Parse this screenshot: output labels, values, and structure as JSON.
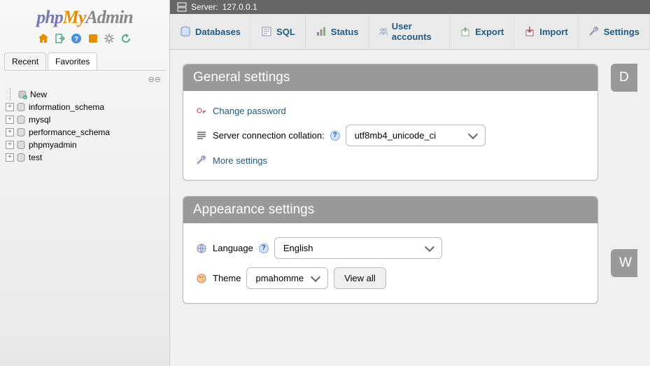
{
  "logo": {
    "php": "php",
    "my": "My",
    "admin": "Admin"
  },
  "sidebar": {
    "tabs": [
      "Recent",
      "Favorites"
    ],
    "activeTab": 0,
    "newLabel": "New",
    "databases": [
      "information_schema",
      "mysql",
      "performance_schema",
      "phpmyadmin",
      "test"
    ]
  },
  "breadcrumb": {
    "serverLabel": "Server:",
    "serverValue": "127.0.0.1"
  },
  "topnav": [
    "Databases",
    "SQL",
    "Status",
    "User accounts",
    "Export",
    "Import",
    "Settings"
  ],
  "general": {
    "title": "General settings",
    "changePassword": "Change password",
    "collationLabel": "Server connection collation:",
    "collationValue": "utf8mb4_unicode_ci",
    "moreSettings": "More settings"
  },
  "appearance": {
    "title": "Appearance settings",
    "languageLabel": "Language",
    "languageValue": "English",
    "themeLabel": "Theme",
    "themeValue": "pmahomme",
    "viewAll": "View all"
  },
  "rightPanels": [
    "D",
    "W"
  ]
}
